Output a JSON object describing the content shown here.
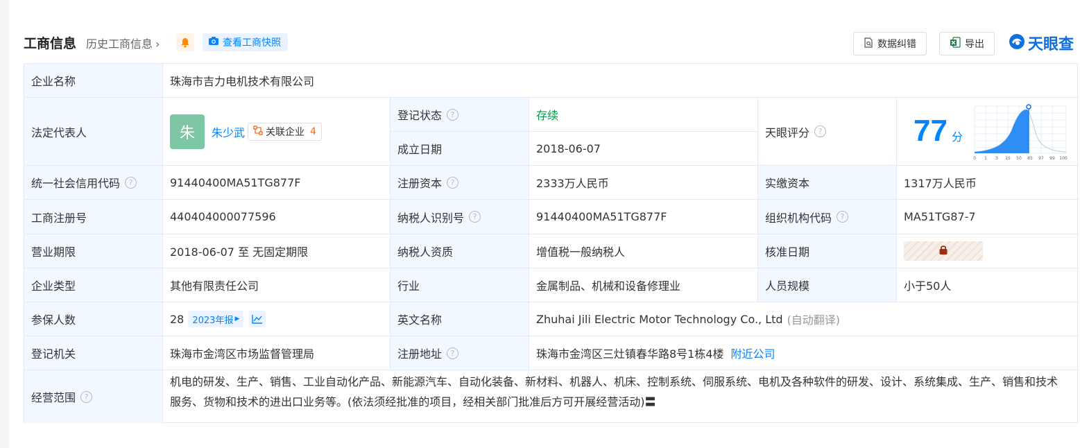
{
  "header": {
    "title": "工商信息",
    "history_link": "历史工商信息",
    "snapshot_btn": "查看工商快照",
    "report_btn": "数据纠错",
    "export_btn": "导出",
    "logo_text": "天眼查"
  },
  "company": {
    "name_label": "企业名称",
    "name": "珠海市吉力电机技术有限公司",
    "rep_label": "法定代表人",
    "rep_avatar": "朱",
    "rep_name": "朱少武",
    "related_label": "关联企业",
    "related_count": "4",
    "status_label": "登记状态",
    "status": "存续",
    "founded_label": "成立日期",
    "founded": "2018-06-07",
    "score_label": "天眼评分",
    "score": "77",
    "score_unit": "分",
    "credit_label": "统一社会信用代码",
    "credit": "91440400MA51TG877F",
    "capital_label": "注册资本",
    "capital": "2333万人民币",
    "paid_label": "实缴资本",
    "paid": "1317万人民币",
    "regno_label": "工商注册号",
    "regno": "440404000077596",
    "taxid_label": "纳税人识别号",
    "taxid": "91440400MA51TG877F",
    "orgcode_label": "组织机构代码",
    "orgcode": "MA51TG87-7",
    "term_label": "营业期限",
    "term": "2018-06-07 至 无固定期限",
    "taxpayer_label": "纳税人资质",
    "taxpayer": "增值税一般纳税人",
    "approve_label": "核准日期",
    "type_label": "企业类型",
    "type": "其他有限责任公司",
    "industry_label": "行业",
    "industry": "金属制品、机械和设备修理业",
    "staff_label": "人员规模",
    "staff": "小于50人",
    "insured_label": "参保人数",
    "insured": "28",
    "insured_year": "2023年报",
    "en_label": "英文名称",
    "en_name": "Zhuhai Jili Electric Motor Technology Co., Ltd",
    "en_note": "(自动翻译)",
    "authority_label": "登记机关",
    "authority": "珠海市金湾区市场监督管理局",
    "address_label": "注册地址",
    "address": "珠海市金湾区三灶镇春华路8号1栋4楼",
    "nearby_link": "附近公司",
    "scope_label": "经营范围",
    "scope": "机电的研发、生产、销售、工业自动化产品、新能源汽车、自动化装备、新材料、机器人、机床、控制系统、伺服系统、电机及各种软件的研发、设计、系统集成、生产、销售和技术服务、货物和技术的进出口业务等。(依法须经批准的项目，经相关部门批准后方可开展经营活动)〓"
  },
  "score_chart": {
    "x_ticks": [
      "0",
      "1",
      "3",
      "15",
      "50",
      "85",
      "97",
      "99",
      "100"
    ],
    "marker_value": "77"
  },
  "colors": {
    "accent": "#0084ff",
    "label_bg": "#f2f8ff",
    "status_green": "#009944"
  }
}
